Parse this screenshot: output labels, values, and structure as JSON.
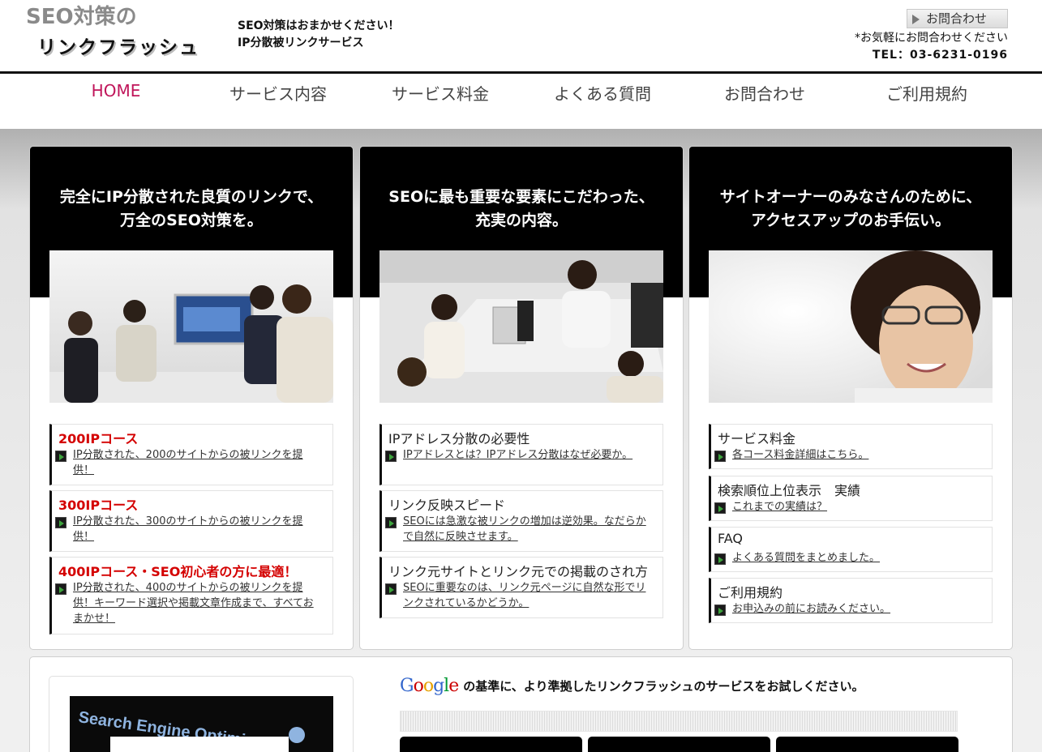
{
  "header": {
    "logo_line1": "SEO対策の",
    "logo_line2": "リンクフラッシュ",
    "tagline_1": "SEO対策はおまかせください！",
    "tagline_2": "IP分散被リンクサービス",
    "contact_button": "お問合わせ",
    "note": "*お気軽にお問合わせください",
    "tel": "TEL：03-6231-0196"
  },
  "nav": {
    "items": [
      {
        "label": "HOME",
        "active": true
      },
      {
        "label": "サービス内容"
      },
      {
        "label": "サービス料金"
      },
      {
        "label": "よくある質問"
      },
      {
        "label": "お問合わせ"
      },
      {
        "label": "ご利用規約"
      }
    ]
  },
  "panels": [
    {
      "title_1": "完全にIP分散された良質のリンクで、",
      "title_2": "万全のSEO対策を。",
      "items": [
        {
          "title": "200IPコース",
          "link": "IP分散された、200のサイトからの被リンクを提供！"
        },
        {
          "title": "300IPコース",
          "link": "IP分散された、300のサイトからの被リンクを提供！"
        },
        {
          "title": "400IPコース・SEO初心者の方に最適！",
          "link": "IP分散された、400のサイトからの被リンクを提供！キーワード選択や掲載文章作成まで、すべておまかせ！"
        }
      ]
    },
    {
      "title_1": "SEOに最も重要な要素にこだわった、",
      "title_2": "充実の内容。",
      "items": [
        {
          "title": "IPアドレス分散の必要性",
          "link": "IPアドレスとは？IPアドレス分散はなぜ必要か。"
        },
        {
          "title": "リンク反映スピード",
          "link": "SEOには急激な被リンクの増加は逆効果。なだらかで自然に反映させます。"
        },
        {
          "title": "リンク元サイトとリンク元での掲載のされ方",
          "link": "SEOに重要なのは、リンク元ページに自然な形でリンクされているかどうか。"
        }
      ]
    },
    {
      "title_1": "サイトオーナーのみなさんのために、",
      "title_2": "アクセスアップのお手伝い。",
      "items": [
        {
          "title": "サービス料金",
          "link": "各コース料金詳細はこちら。"
        },
        {
          "title": "検索順位上位表示　実績",
          "link": "これまでの実績は？"
        },
        {
          "title": "FAQ",
          "link": "よくある質問をまとめました。"
        },
        {
          "title": "ご利用規約",
          "link": "お申込みの前にお読みください。"
        }
      ]
    }
  ],
  "lower": {
    "image_text": "Search Engine Optimi",
    "google_logo": "Google",
    "google_text": "の基準に、より準拠したリンクフラッシュのサービスをお試しください。"
  },
  "colors": {
    "nav_active": "#c0155a",
    "course_title": "#d40000",
    "bullet_arrow": "#3da33d"
  }
}
